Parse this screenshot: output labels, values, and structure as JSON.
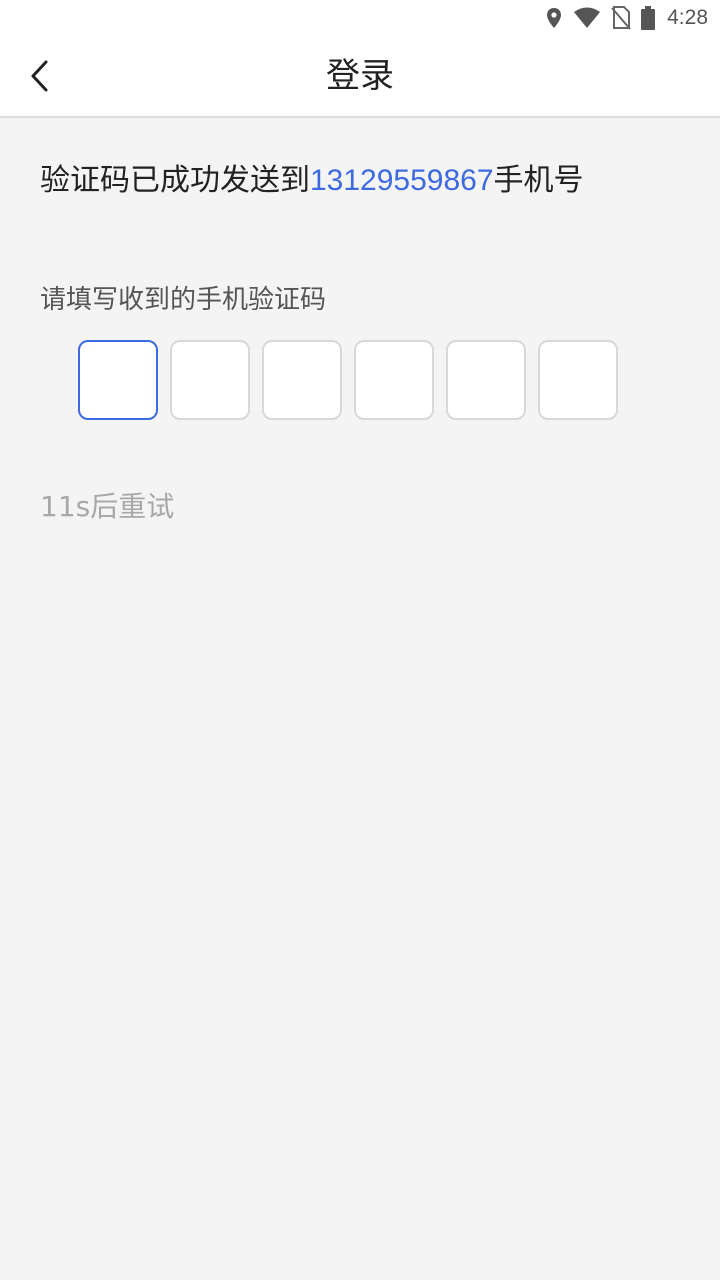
{
  "status_bar": {
    "time": "4:28",
    "icons": [
      "location-icon",
      "wifi-icon",
      "no-sim-icon",
      "battery-icon"
    ]
  },
  "nav": {
    "title": "登录",
    "back_icon": "chevron-left-icon"
  },
  "message": {
    "prefix": "验证码已成功发送到",
    "phone": "13129559867",
    "suffix": "手机号"
  },
  "code_input": {
    "prompt": "请填写收到的手机验证码",
    "length": 6,
    "values": [
      "",
      "",
      "",
      "",
      "",
      ""
    ],
    "active_index": 0
  },
  "resend": {
    "label": "11s后重试"
  },
  "colors": {
    "accent": "#3d6ae0",
    "background": "#f4f4f4",
    "muted": "#a8a8a8"
  }
}
